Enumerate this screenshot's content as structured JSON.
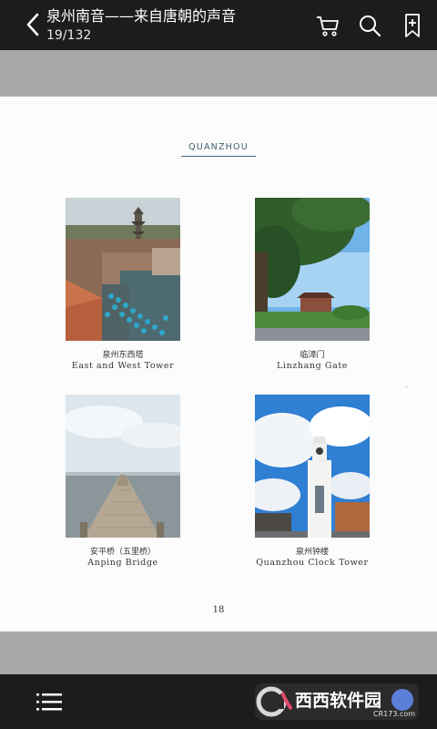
{
  "header": {
    "title": "泉州南音——来自唐朝的声音",
    "page_indicator": "19/132"
  },
  "page": {
    "section_label": "QUANZHOU",
    "page_number": "18",
    "photos": [
      {
        "caption_cn": "泉州东西塔",
        "caption_en": "East and West Tower"
      },
      {
        "caption_cn": "临漳门",
        "caption_en": "Linzhang Gate"
      },
      {
        "caption_cn": "安平桥（五里桥）",
        "caption_en": "Anping Bridge"
      },
      {
        "caption_cn": "泉州钟楼",
        "caption_en": "Quanzhou Clock Tower"
      }
    ]
  },
  "watermark": {
    "brand": "西西软件园",
    "domain": "CR173.com"
  },
  "icons": {
    "back": "chevron-left-icon",
    "cart": "cart-icon",
    "search": "search-icon",
    "bookmark": "bookmark-add-icon",
    "menu": "list-menu-icon"
  },
  "colors": {
    "bars": "#1c1c1c",
    "backdrop": "#a8a8a8",
    "page": "#fcfcfc",
    "section_accent": "#3e5f6e"
  }
}
